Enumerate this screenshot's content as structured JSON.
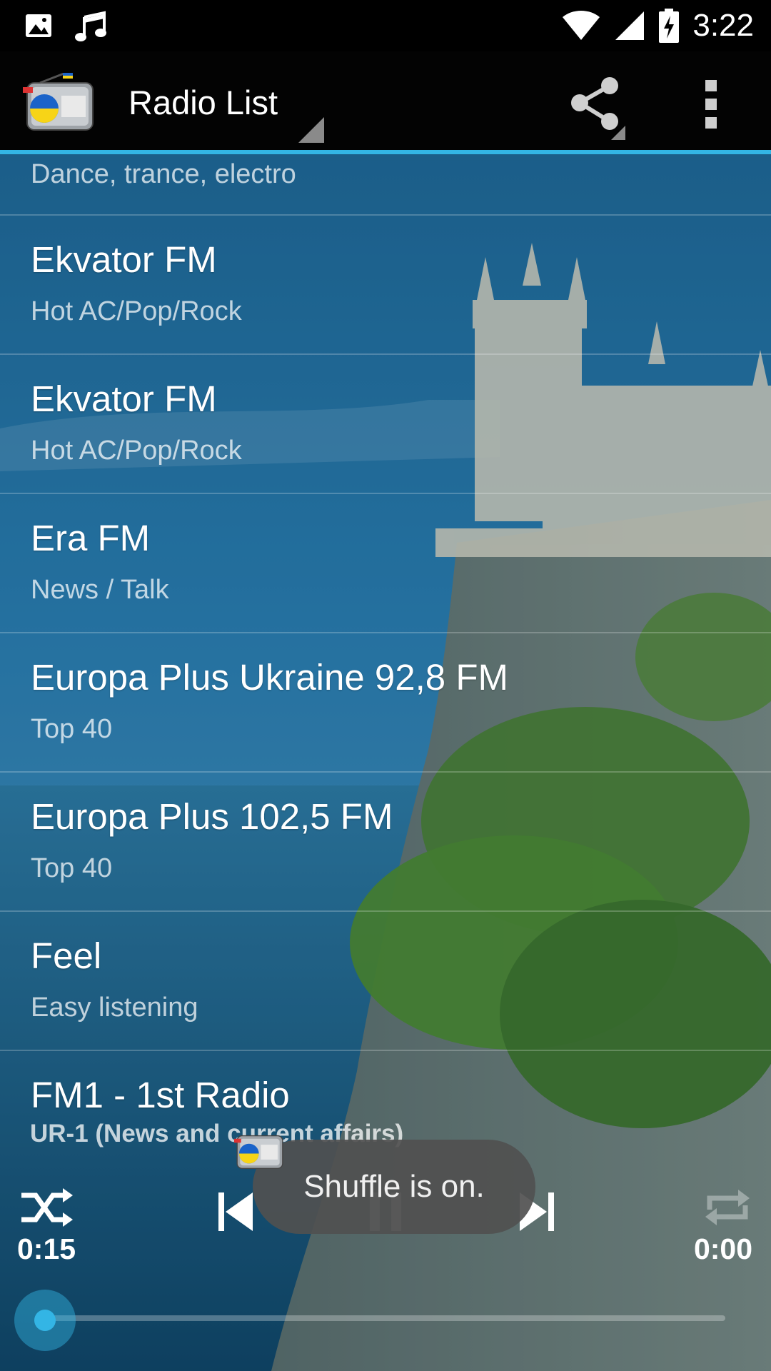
{
  "status_bar": {
    "time": "3:22",
    "left_icons": [
      "image-notification-icon",
      "music-notification-icon"
    ],
    "right_icons": [
      "wifi-icon",
      "cell-signal-icon",
      "battery-charging-icon"
    ]
  },
  "action_bar": {
    "title": "Radio List",
    "logo_icon": "radio-app-logo",
    "actions": [
      "share-icon",
      "overflow-menu-icon"
    ],
    "accent_color": "#33b5e5"
  },
  "stations": [
    {
      "name": "",
      "genre": "Dance, trance, electro"
    },
    {
      "name": "Ekvator FM",
      "genre": "Hot AC/Pop/Rock"
    },
    {
      "name": "Ekvator FM",
      "genre": "Hot AC/Pop/Rock"
    },
    {
      "name": "Era FM",
      "genre": "News / Talk"
    },
    {
      "name": "Europa Plus Ukraine 92,8 FM",
      "genre": "Top 40"
    },
    {
      "name": "Europa Plus 102,5 FM",
      "genre": "Top 40"
    },
    {
      "name": "Feel",
      "genre": "Easy listening"
    },
    {
      "name": "FM1 - 1st Radio",
      "genre": ""
    }
  ],
  "player": {
    "now_playing": "UR-1 (News and current affairs)",
    "elapsed": "0:15",
    "duration": "0:00",
    "progress_fraction": 0.0,
    "shuffle_on": true,
    "controls": [
      "shuffle-icon",
      "previous-icon",
      "pause-icon",
      "next-icon",
      "repeat-icon"
    ]
  },
  "toast": {
    "message": "Shuffle is on."
  }
}
